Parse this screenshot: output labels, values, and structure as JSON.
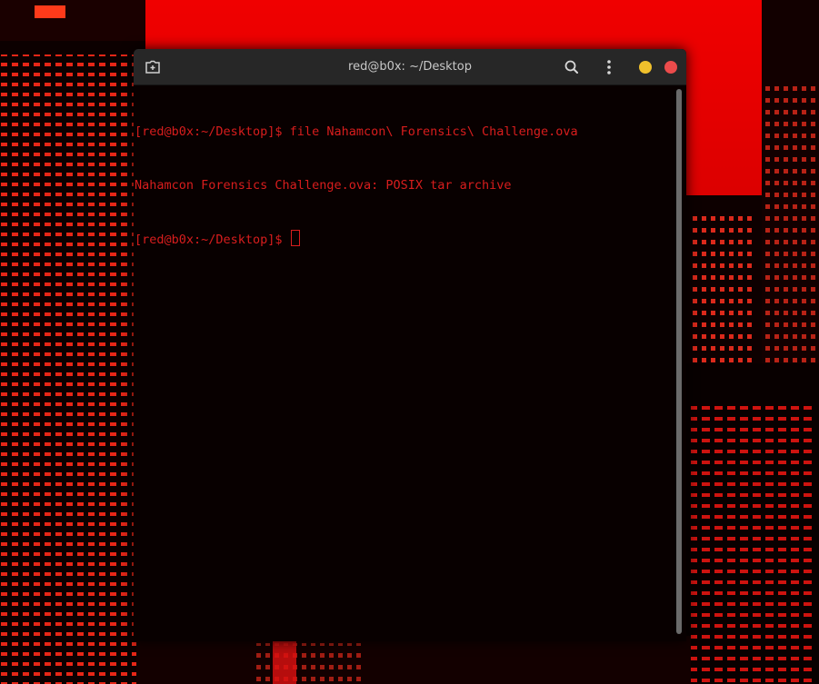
{
  "window": {
    "title": "red@b0x: ~/Desktop"
  },
  "titlebar": {
    "new_tab_icon": "new-tab-icon",
    "search_icon": "search-icon",
    "menu_icon": "kebab-menu-icon",
    "minimize_icon": "minimize-circle-icon",
    "close_icon": "close-circle-icon"
  },
  "terminal": {
    "lines": [
      "[red@b0x:~/Desktop]$ file Nahamcon\\ Forensics\\ Challenge.ova",
      "Nahamcon Forensics Challenge.ova: POSIX tar archive",
      "[red@b0x:~/Desktop]$ "
    ]
  },
  "colors": {
    "terminal_text": "#d81d1d",
    "titlebar_bg": "#272727",
    "title_text": "#c8c8c8",
    "minimize": "#f0c02c",
    "close": "#ec4b4b",
    "terminal_bg": "#080000",
    "scrollbar": "#6a6a6a",
    "wallpaper_sky": "#e40000"
  }
}
